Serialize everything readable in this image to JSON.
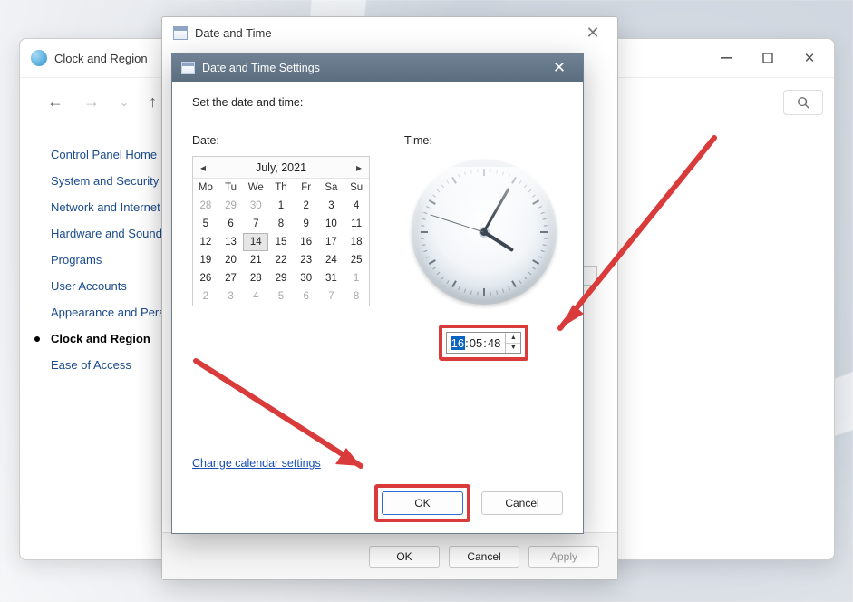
{
  "window_cp": {
    "title": "Clock and Region",
    "sidebar": {
      "header": "Control Panel Home",
      "items": [
        "System and Security",
        "Network and Internet",
        "Hardware and Sound",
        "Programs",
        "User Accounts",
        "Appearance and Personalization",
        "Clock and Region",
        "Ease of Access"
      ],
      "active_index": 6
    }
  },
  "window_dt": {
    "title": "Date and Time",
    "buttons": {
      "ok": "OK",
      "cancel": "Cancel",
      "apply": "Apply"
    }
  },
  "window_dts": {
    "title": "Date and Time Settings",
    "instruction": "Set the date and time:",
    "date_label": "Date:",
    "time_label": "Time:",
    "link": "Change calendar settings",
    "buttons": {
      "ok": "OK",
      "cancel": "Cancel"
    },
    "calendar": {
      "month_label": "July, 2021",
      "dow": [
        "Mo",
        "Tu",
        "We",
        "Th",
        "Fr",
        "Sa",
        "Su"
      ],
      "weeks": [
        [
          {
            "d": 28,
            "out": true
          },
          {
            "d": 29,
            "out": true
          },
          {
            "d": 30,
            "out": true
          },
          {
            "d": 1
          },
          {
            "d": 2
          },
          {
            "d": 3
          },
          {
            "d": 4
          }
        ],
        [
          {
            "d": 5
          },
          {
            "d": 6
          },
          {
            "d": 7
          },
          {
            "d": 8
          },
          {
            "d": 9
          },
          {
            "d": 10
          },
          {
            "d": 11
          }
        ],
        [
          {
            "d": 12
          },
          {
            "d": 13
          },
          {
            "d": 14,
            "sel": true
          },
          {
            "d": 15
          },
          {
            "d": 16
          },
          {
            "d": 17
          },
          {
            "d": 18
          }
        ],
        [
          {
            "d": 19
          },
          {
            "d": 20
          },
          {
            "d": 21
          },
          {
            "d": 22
          },
          {
            "d": 23
          },
          {
            "d": 24
          },
          {
            "d": 25
          }
        ],
        [
          {
            "d": 26
          },
          {
            "d": 27
          },
          {
            "d": 28
          },
          {
            "d": 29
          },
          {
            "d": 30
          },
          {
            "d": 31
          },
          {
            "d": 1,
            "out": true
          }
        ],
        [
          {
            "d": 2,
            "out": true
          },
          {
            "d": 3,
            "out": true
          },
          {
            "d": 4,
            "out": true
          },
          {
            "d": 5,
            "out": true
          },
          {
            "d": 6,
            "out": true
          },
          {
            "d": 7,
            "out": true
          },
          {
            "d": 8,
            "out": true
          }
        ]
      ]
    },
    "time": {
      "hour": "16",
      "minute": "05",
      "second": "48",
      "selected_segment": "hour"
    }
  },
  "colors": {
    "highlight": "#d93a3a",
    "accent": "#2a6fd6"
  }
}
